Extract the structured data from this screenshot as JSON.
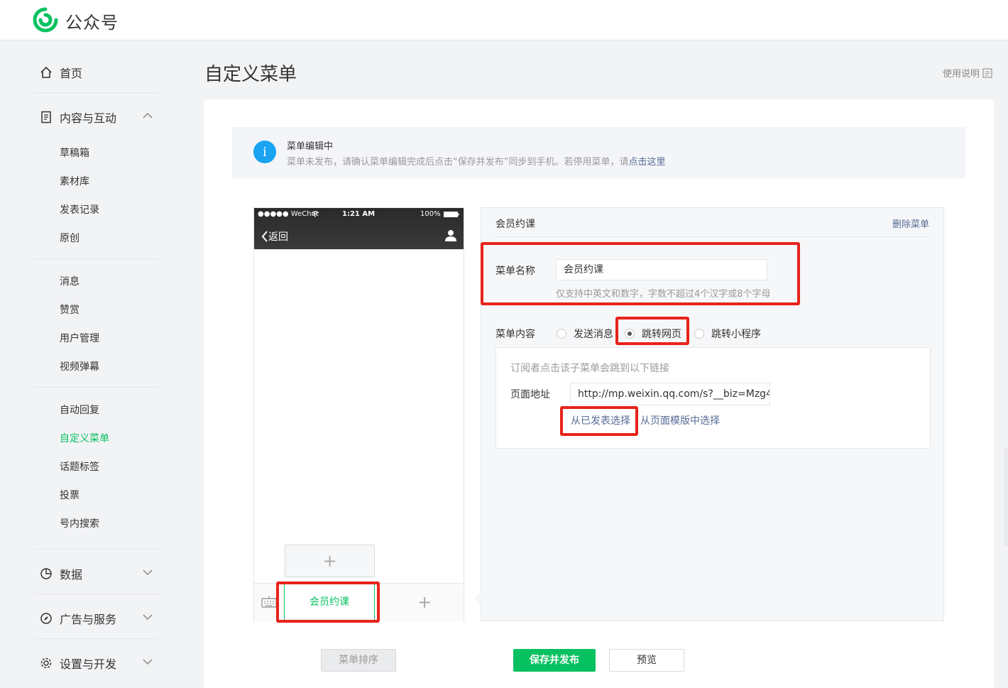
{
  "header": {
    "brand": "公众号"
  },
  "sidebar": {
    "home": "首页",
    "content_group": "内容与互动",
    "content_items": [
      "草稿箱",
      "素材库",
      "发表记录",
      "原创"
    ],
    "message_items": [
      "消息",
      "赞赏",
      "用户管理",
      "视频弹幕"
    ],
    "reply_items": [
      "自动回复",
      "自定义菜单",
      "话题标签",
      "投票",
      "号内搜索"
    ],
    "data": "数据",
    "ads": "广告与服务",
    "settings": "设置与开发",
    "active_color": "#07c160"
  },
  "page": {
    "title": "自定义菜单",
    "help": "使用说明"
  },
  "notice": {
    "title": "菜单编辑中",
    "desc": "菜单未发布，请确认菜单编辑完成后点击“保存并发布”同步到手机。若停用菜单，请",
    "link": "点击这里"
  },
  "phone": {
    "carrier": "●●●●● WeChat",
    "time": "1:21 AM",
    "battery": "100%",
    "back": "返回",
    "menu_label": "会员约课"
  },
  "editor": {
    "title": "会员约课",
    "delete": "删除菜单",
    "name_label": "菜单名称",
    "name_value": "会员约课",
    "name_hint": "仅支持中英文和数字，字数不超过4个汉字或8个字母",
    "content_label": "菜单内容",
    "options": [
      "发送消息",
      "跳转网页",
      "跳转小程序"
    ],
    "selected_option": "跳转网页",
    "url_desc": "订阅者点击该子菜单会跳到以下链接",
    "url_label": "页面地址",
    "url_value": "http://mp.weixin.qq.com/s?__biz=Mzg4",
    "choose_published": "从已发表选择",
    "choose_template": "从页面模版中选择"
  },
  "buttons": {
    "sort": "菜单排序",
    "save": "保存并发布",
    "preview": "预览"
  }
}
